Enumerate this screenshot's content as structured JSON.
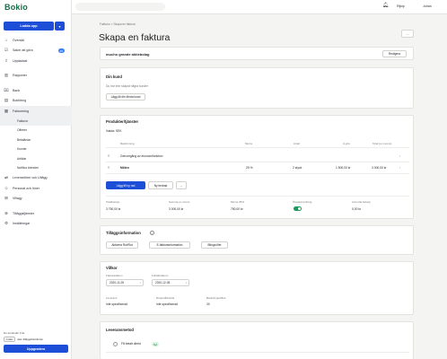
{
  "app": {
    "logo": "Bokio",
    "search_placeholder": ""
  },
  "topbar": {
    "company": "Rijkip",
    "user": "Johan"
  },
  "sidebar": {
    "upload_label": "Ladda upp",
    "items": [
      {
        "label": "Översikt",
        "icon": "home-icon"
      },
      {
        "label": "Saker att göra",
        "icon": "checklist-icon",
        "badge": "20"
      },
      {
        "label": "Uppladdat",
        "icon": "upload-icon"
      },
      {
        "label": "Rapporter",
        "icon": "chart-icon"
      },
      {
        "label": "Bank",
        "icon": "bank-icon"
      },
      {
        "label": "Bokföring",
        "icon": "book-icon"
      },
      {
        "label": "Fakturering",
        "icon": "invoice-icon"
      },
      {
        "label": "Leverantörer och Utlägg",
        "icon": "supplier-icon"
      },
      {
        "label": "Personal och löner",
        "icon": "people-icon"
      },
      {
        "label": "Villagy",
        "icon": "grid-icon"
      },
      {
        "label": "Tilläggstjänster",
        "icon": "plugin-icon"
      },
      {
        "label": "Inställningar",
        "icon": "gear-icon"
      }
    ],
    "sub_items": [
      "Fakturor",
      "Offerter",
      "Betalärdar",
      "Kunder",
      "Artiklar",
      "Notifica ärenden"
    ],
    "plan_label": "Du använder Fria",
    "plan_tag": "Gratis",
    "plan_text": "utan tilläggsfunktioner",
    "upgrade_label": "Uppgradera"
  },
  "breadcrumb": "Fakturor > Skapa en faktura",
  "page_title": "Skapa en faktura",
  "more_label": "...",
  "company_card": {
    "name": "mucho grande aktiebolag",
    "edit_label": "Redigera"
  },
  "customer_card": {
    "title": "Din kund",
    "empty_text": "Du har inte skapat några kunder",
    "add_label": "Lägg till din första kund"
  },
  "products": {
    "title": "Produkter/tjänster",
    "currency": "Valuta: SEK",
    "headers": [
      "Beskrivning",
      "Moms",
      "Antal",
      "À-pris",
      "Total (ex moms)"
    ],
    "rows": [
      {
        "description": "Genomgång av ekonomifunktion",
        "vat": "",
        "qty": "",
        "price": "",
        "total": ""
      },
      {
        "description": "Möten",
        "vat": "25 %",
        "qty": "2 styck",
        "price": "1 500,00 kr",
        "total": "3 000,00 kr"
      }
    ],
    "add_row_label": "Lägg till ny rad",
    "add_text_label": "Ny textrad",
    "more_label": "...",
    "summary": [
      {
        "label": "Totalbelopp",
        "value": "3 750,00 kr"
      },
      {
        "label": "Summa ex moms",
        "value": "3 000,00 kr"
      },
      {
        "label": "Moms 25%",
        "value": "750,00 kr"
      },
      {
        "label": "Öresavrundning",
        "value": ""
      },
      {
        "label": "Avrunda belopp",
        "value": "0,00 kr"
      }
    ]
  },
  "addons": {
    "title": "Tilläggsinformation",
    "buttons": [
      "Aktivera Rot/Rut",
      "E-fakturainformation",
      "Bifoga filer"
    ]
  },
  "terms": {
    "title": "Villkor",
    "invoice_date_label": "Fakturadatum",
    "invoice_date": "2020-11-05",
    "due_date_label": "Förfallodatum",
    "due_date": "2020-12-05",
    "fields": [
      {
        "label": "Leverans",
        "value": "Inte specificerad"
      },
      {
        "label": "Dröjsmålsränta",
        "value": "Inte specificerad"
      },
      {
        "label": "Betalningsvillkor",
        "value": "30"
      }
    ]
  },
  "delivery": {
    "title": "Leveransmetod",
    "options": [
      {
        "label": "Få betalt direkt",
        "tag": "Nyt"
      }
    ]
  }
}
